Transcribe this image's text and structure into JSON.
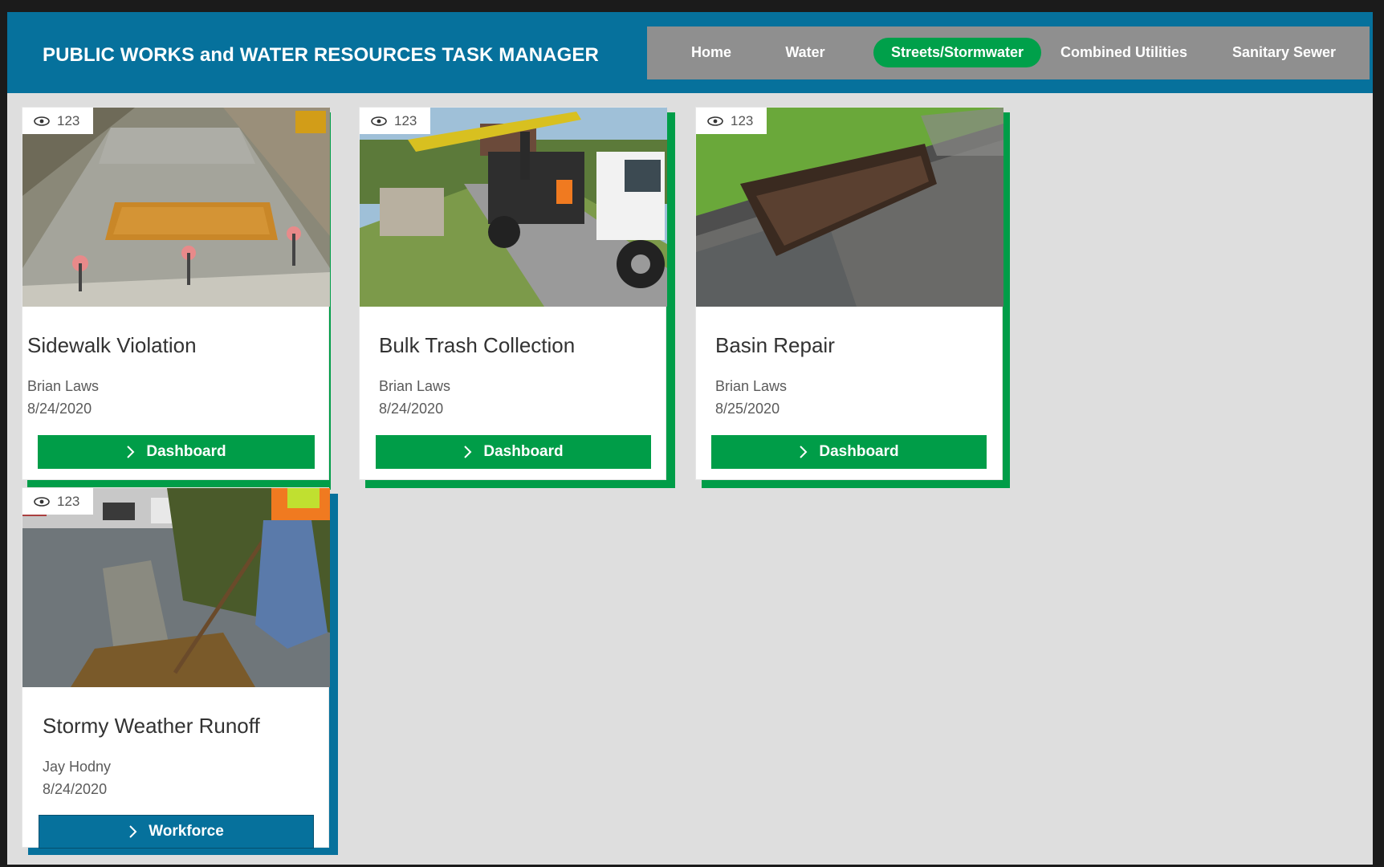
{
  "app": {
    "title": "PUBLIC WORKS and WATER RESOURCES TASK MANAGER",
    "colors": {
      "header": "#06719c",
      "accent_green": "#00a04a",
      "accent_blue": "#06719c",
      "nav_bg": "#8f8f8f"
    }
  },
  "nav": {
    "items": [
      {
        "label": "Home"
      },
      {
        "label": "Water"
      },
      {
        "label": "Streets/Stormwater",
        "active": true
      },
      {
        "label": "Combined Utilities"
      },
      {
        "label": "Sanitary Sewer"
      }
    ]
  },
  "cards": [
    {
      "views": "123",
      "title": "Sidewalk Violation",
      "owner": "Brian Laws",
      "date": "8/24/2020",
      "button": "Dashboard",
      "image": "fresh concrete sidewalk with tactile pad"
    },
    {
      "views": "123",
      "title": "Bulk Trash Collection",
      "owner": "Brian Laws",
      "date": "8/24/2020",
      "button": "Dashboard",
      "image": "grapple truck collecting bulk trash"
    },
    {
      "views": "123",
      "title": "Basin Repair",
      "owner": "Brian Laws",
      "date": "8/25/2020",
      "button": "Dashboard",
      "image": "storm drain basin grate at curb"
    },
    {
      "views": "123",
      "title": "Stormy Weather Runoff",
      "owner": "Jay Hodny",
      "date": "8/24/2020",
      "button": "Workforce",
      "image": "worker raking leaves from flooded gutter"
    }
  ],
  "icons": {
    "views": "eye-icon",
    "button": "chevron-right-icon"
  }
}
